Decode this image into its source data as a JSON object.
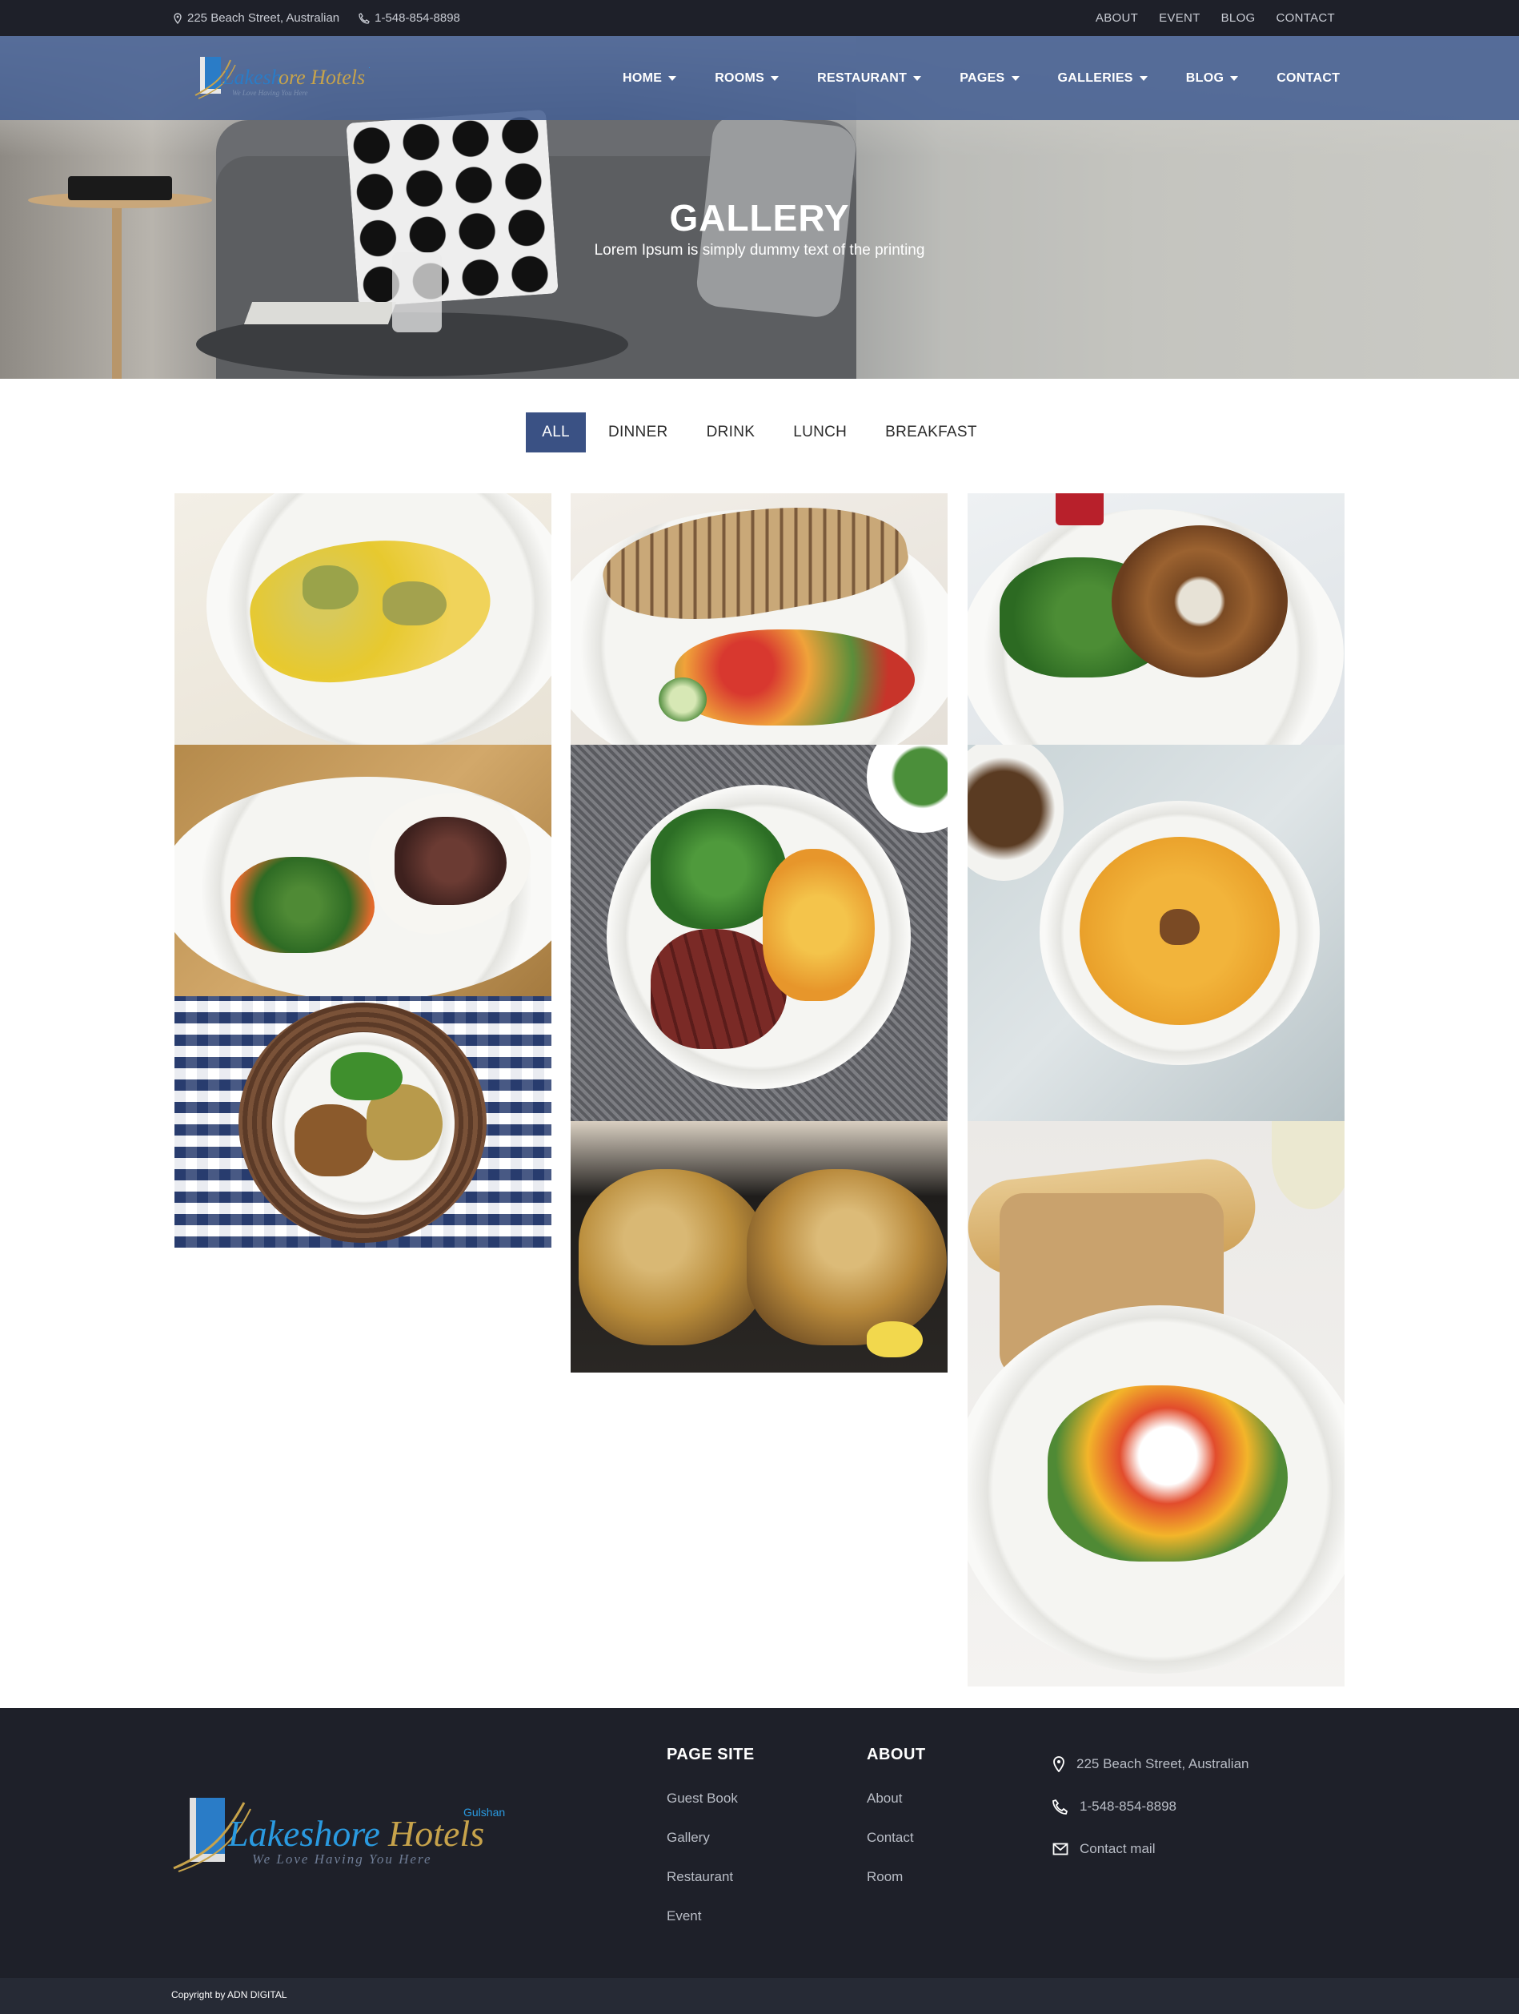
{
  "topbar": {
    "address": "225 Beach Street, Australian",
    "phone": "1-548-854-8898",
    "links": [
      "ABOUT",
      "EVENT",
      "BLOG",
      "CONTACT"
    ]
  },
  "brand": {
    "name": "Lakeshore Hotels",
    "badge": "Gulshan",
    "tagline": "We Love Having You Here"
  },
  "nav": [
    {
      "label": "HOME",
      "dropdown": true
    },
    {
      "label": "ROOMS",
      "dropdown": true
    },
    {
      "label": "RESTAURANT",
      "dropdown": true
    },
    {
      "label": "PAGES",
      "dropdown": true
    },
    {
      "label": "GALLERIES",
      "dropdown": true
    },
    {
      "label": "BLOG",
      "dropdown": true
    },
    {
      "label": "CONTACT",
      "dropdown": false
    }
  ],
  "hero": {
    "title": "GALLERY",
    "subtitle": "Lorem Ipsum is simply dummy text of the printing"
  },
  "filters": {
    "items": [
      "ALL",
      "DINNER",
      "DRINK",
      "LUNCH",
      "BREAKFAST"
    ],
    "active": "ALL"
  },
  "gallery": [
    {
      "name": "ravioli"
    },
    {
      "name": "grilled-fish"
    },
    {
      "name": "bagel-sandwich"
    },
    {
      "name": "steak-salad"
    },
    {
      "name": "beef-vegetable-plate"
    },
    {
      "name": "pumpkin-soup"
    },
    {
      "name": "checkered-table-plate"
    },
    {
      "name": "roast-chicken"
    },
    {
      "name": "burrata-plate"
    }
  ],
  "footer": {
    "page_site": {
      "title": "PAGE SITE",
      "links": [
        "Guest Book",
        "Gallery",
        "Restaurant",
        "Event"
      ]
    },
    "about": {
      "title": "ABOUT",
      "links": [
        "About",
        "Contact",
        "Room"
      ]
    },
    "contact": {
      "address": "225 Beach Street, Australian",
      "phone": "1-548-854-8898",
      "mail": "Contact mail"
    },
    "copyright": "Copyright by ADN DIGITAL"
  },
  "colors": {
    "topbar_bg": "#1e2029",
    "nav_bg": "#3f5a8f",
    "accent": "#3a5184",
    "footer_bg": "#1e2029"
  }
}
